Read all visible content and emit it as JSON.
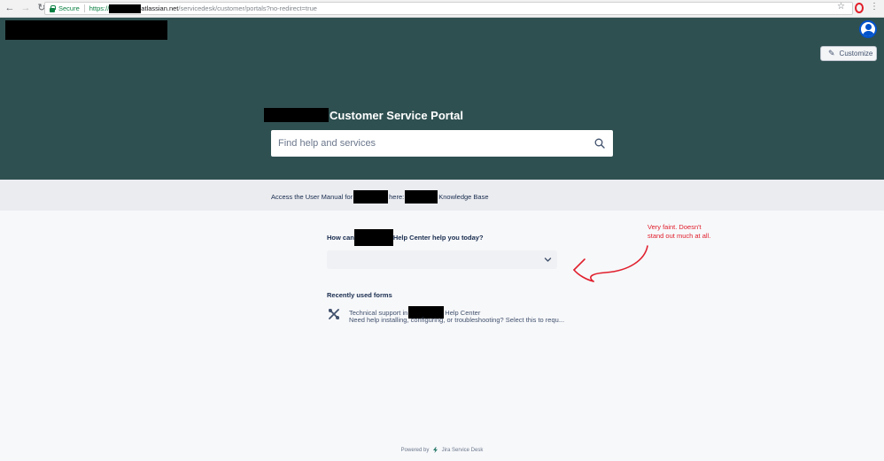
{
  "browser": {
    "secure_label": "Secure",
    "url_protocol": "https://",
    "url_domain": "atlassian.net",
    "url_path": "/servicedesk/customer/portals?no-redirect=true"
  },
  "header": {
    "customize_label": "Customize",
    "portal_title": "Customer Service Portal",
    "search": {
      "placeholder": "Find help and services"
    },
    "background_color": "#2f5051"
  },
  "announcement": {
    "part1": "Access the User Manual for",
    "part2": "here:",
    "part3": "Knowledge Base"
  },
  "main": {
    "question_part1": "How can",
    "question_part2": "Help Center help you today?",
    "recent_heading": "Recently used forms",
    "recent_forms": [
      {
        "title_part1": "Technical support in",
        "title_part2": "Help Center",
        "description": "Need help installing, configuring, or troubleshooting? Select this to requ..."
      }
    ]
  },
  "annotation": {
    "line1": "Very faint. Doesn't",
    "line2": "stand out much at all.",
    "color": "#e0202d"
  },
  "footer": {
    "powered_by": "Powered by",
    "product": "Jira Service Desk"
  },
  "icons": [
    "back-icon",
    "forward-icon",
    "reload-icon",
    "lock-icon",
    "star-icon",
    "opera-icon",
    "menu-icon",
    "avatar-icon",
    "pencil-icon",
    "search-icon",
    "chevron-down-icon",
    "wrench-icon",
    "jira-bolt-icon",
    "red-arrow-icon"
  ]
}
